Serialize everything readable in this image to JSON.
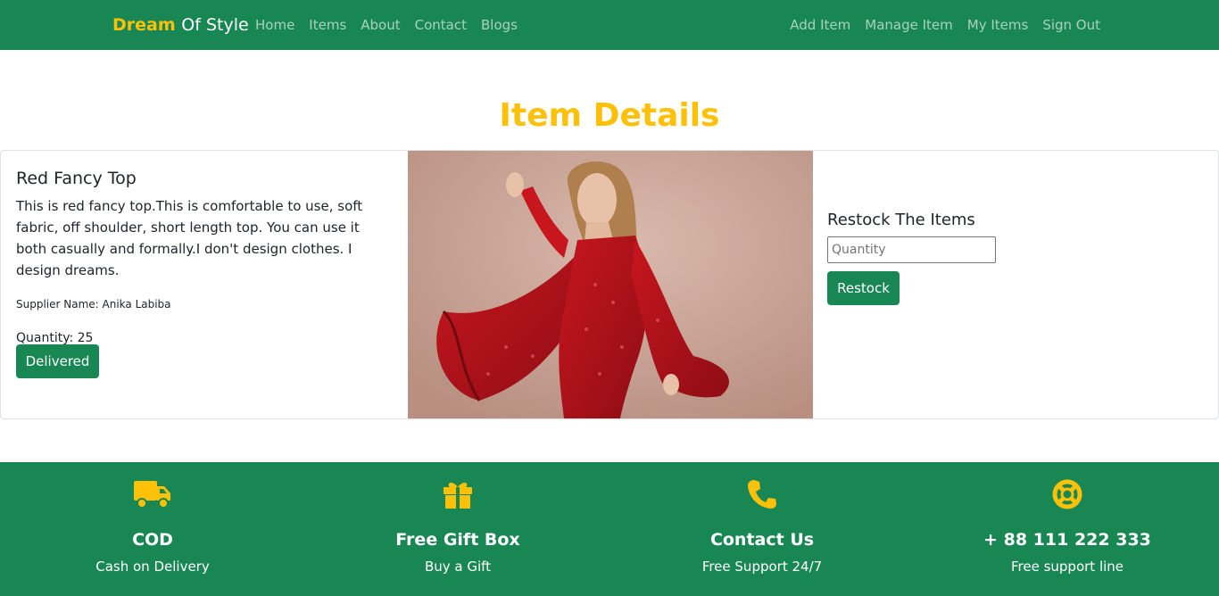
{
  "brand": {
    "part1": "Dream",
    "part2": "Of Style"
  },
  "nav": {
    "left": [
      "Home",
      "Items",
      "About",
      "Contact",
      "Blogs"
    ],
    "right": [
      "Add Item",
      "Manage Item",
      "My Items",
      "Sign Out"
    ]
  },
  "page_title": "Item Details",
  "item": {
    "name": "Red Fancy Top",
    "description": "This is red fancy top.This is comfortable to use, soft fabric, off shoulder, short length top. You can use it both casually and formally.I don't design clothes. I design dreams.",
    "supplier": "Supplier Name: Anika Labiba",
    "quantity": "Quantity: 25",
    "delivered_label": "Delivered"
  },
  "restock": {
    "title": "Restock The Items",
    "placeholder": "Quantity",
    "button_label": "Restock"
  },
  "footer": {
    "features": [
      {
        "icon": "truck-icon",
        "title": "COD",
        "subtitle": "Cash on Delivery"
      },
      {
        "icon": "gift-icon",
        "title": "Free Gift Box",
        "subtitle": "Buy a Gift"
      },
      {
        "icon": "phone-icon",
        "title": "Contact Us",
        "subtitle": "Free Support 24/7"
      },
      {
        "icon": "lifebuoy-icon",
        "title": "+ 88 111 222 333",
        "subtitle": "Free support line"
      }
    ]
  },
  "colors": {
    "primary": "#198754",
    "accent": "#ffc107"
  }
}
